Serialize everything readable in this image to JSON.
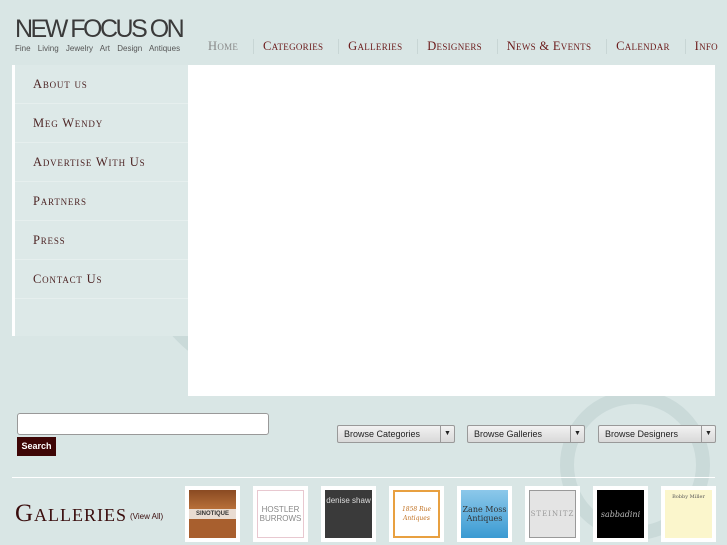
{
  "logo": {
    "title": "NEW FOCUS ON",
    "tagline": "Fine Living Jewelry Art Design Antiques"
  },
  "nav": [
    "Home",
    "Categories",
    "Galleries",
    "Designers",
    "News & Events",
    "Calendar",
    "Info"
  ],
  "sidebar": [
    "About us",
    "Meg Wendy",
    "Advertise With Us",
    "Partners",
    "Press",
    "Contact Us"
  ],
  "search": {
    "value": "",
    "button": "Search"
  },
  "selects": [
    "Browse Categories",
    "Browse Galleries",
    "Browse Designers"
  ],
  "galleries": {
    "title": "Galleries",
    "view_all": "(View All)",
    "items": [
      "SINOTIQUE",
      "HOSTLER BURROWS",
      "denise shaw",
      "1858 Rue Antiques",
      "Zane Moss Antiques",
      "STEINITZ",
      "sabbadini",
      "Bobby Miller"
    ]
  }
}
